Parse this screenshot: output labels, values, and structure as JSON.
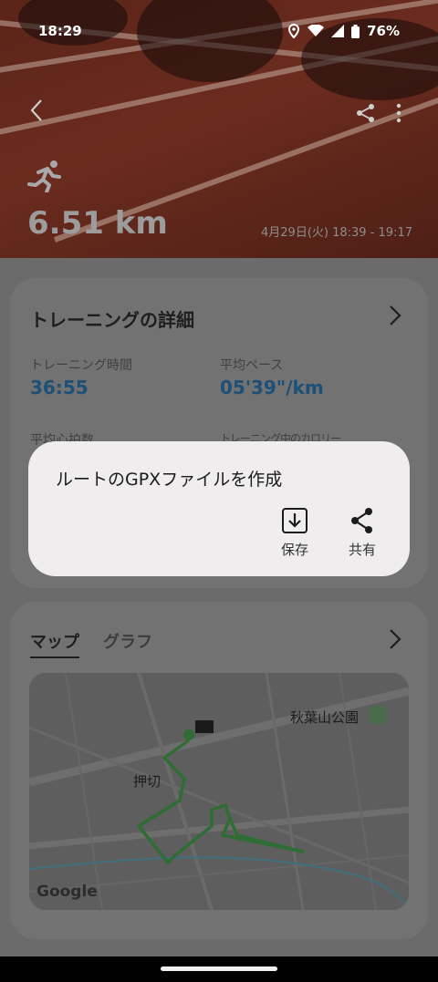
{
  "status": {
    "time": "18:29",
    "battery": "76%"
  },
  "hero": {
    "distance": "6.51 km",
    "datetime": "4月29日(火) 18:39 - 19:17"
  },
  "details": {
    "title": "トレーニングの詳細",
    "metrics": [
      {
        "label": "トレーニング時間",
        "value": "36:55"
      },
      {
        "label": "平均ペース",
        "value": "05'39\"/km"
      },
      {
        "label": "平均心拍数"
      },
      {
        "label": "トレーニング中のカロリー"
      }
    ]
  },
  "dialog": {
    "title": "ルートのGPXファイルを作成",
    "save_label": "保存",
    "share_label": "共有"
  },
  "map_card": {
    "tabs": [
      "マップ",
      "グラフ"
    ],
    "labels": {
      "park": "秋葉山公園",
      "area": "押切",
      "logo": "Google"
    }
  }
}
